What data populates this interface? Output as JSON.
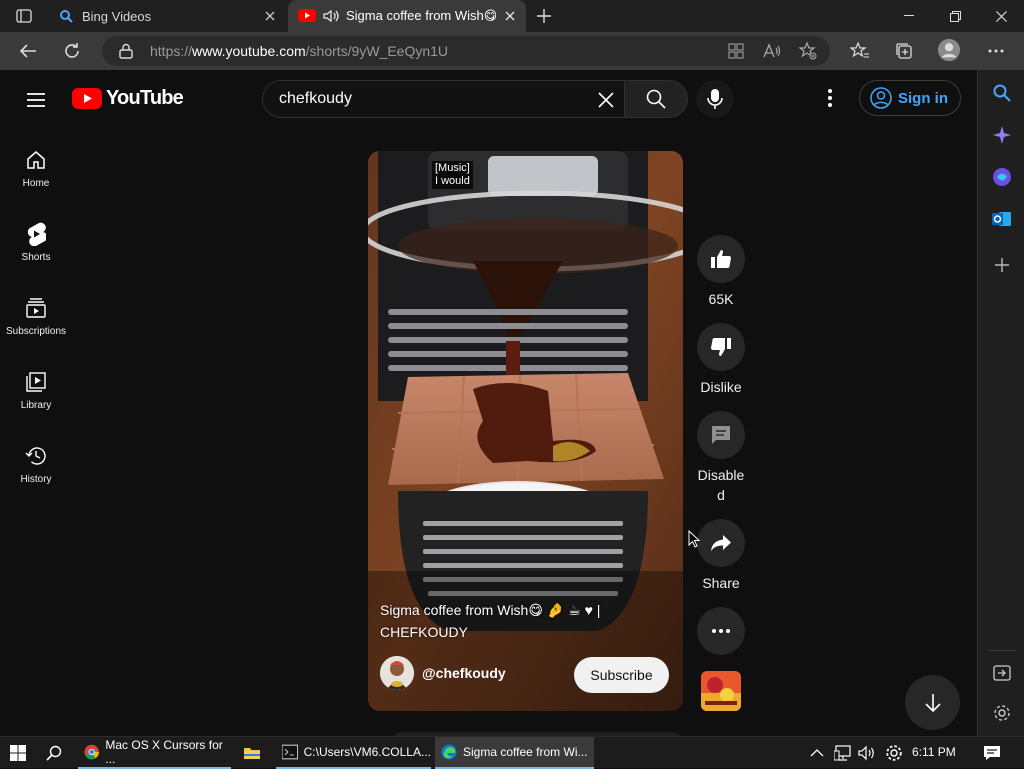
{
  "browser": {
    "tabs": [
      {
        "title": "Bing Videos",
        "icon": "bing-search-icon"
      },
      {
        "title": "Sigma coffee from Wish😋🍫",
        "icon": "youtube-icon",
        "audio": true
      }
    ],
    "url_prefix": "https://",
    "url_host": "www.youtube.com",
    "url_path": "/shorts/9yW_EeQyn1U"
  },
  "youtube": {
    "logo_text": "YouTube",
    "search_value": "chefkoudy",
    "signin_label": "Sign in",
    "nav": [
      {
        "label": "Home",
        "icon": "home-icon"
      },
      {
        "label": "Shorts",
        "icon": "shorts-icon"
      },
      {
        "label": "Subscriptions",
        "icon": "subscriptions-icon"
      },
      {
        "label": "Library",
        "icon": "library-icon"
      },
      {
        "label": "History",
        "icon": "history-icon"
      }
    ],
    "short": {
      "caption_line1": "[Music]",
      "caption_line2": "I would",
      "title": "Sigma coffee from Wish😋 🤌 ☕ ♥ | CHEFKOUDY",
      "channel": "@chefkoudy",
      "subscribe_label": "Subscribe"
    },
    "actions": {
      "like_count": "65K",
      "dislike_label": "Dislike",
      "comments_label": "Disabled",
      "share_label": "Share"
    }
  },
  "taskbar": {
    "items": [
      {
        "label": "Mac OS X Cursors for ...",
        "icon": "chrome-icon"
      },
      {
        "label": "",
        "icon": "file-explorer-icon"
      },
      {
        "label": "C:\\Users\\VM6.COLLA...",
        "icon": "terminal-icon"
      },
      {
        "label": "Sigma coffee from Wi...",
        "icon": "edge-icon"
      }
    ],
    "time": "6:11 PM"
  },
  "colors": {
    "yt_red": "#ff0000",
    "signin_blue": "#3ea6ff",
    "bg": "#0f0f0f"
  }
}
